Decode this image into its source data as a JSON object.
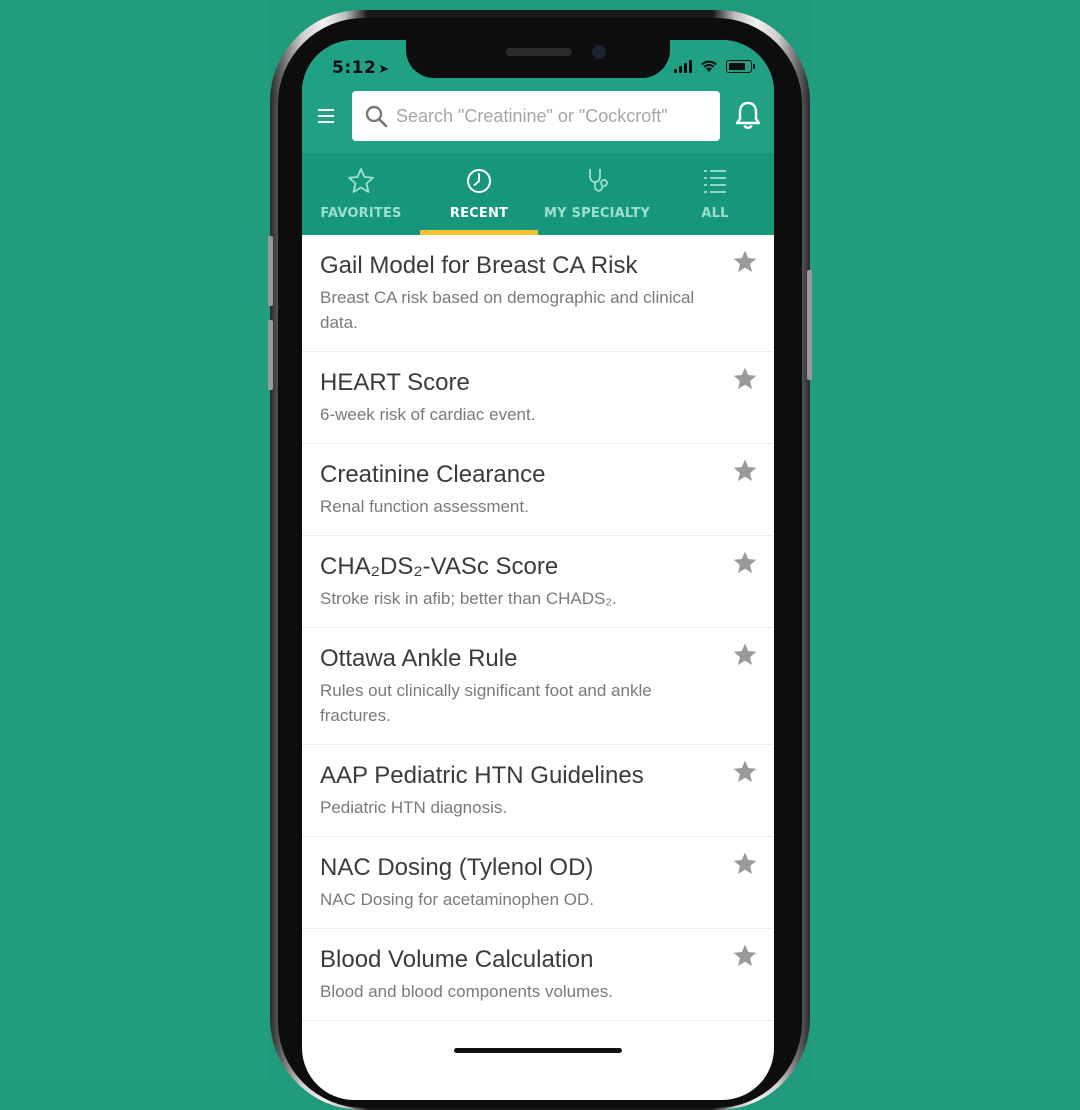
{
  "status_bar": {
    "time": "5:12"
  },
  "header": {
    "search_placeholder": "Search \"Creatinine\" or \"Cockcroft\""
  },
  "tabs": [
    {
      "label": "FAVORITES",
      "icon": "star-outline-icon",
      "active": false
    },
    {
      "label": "RECENT",
      "icon": "clock-icon",
      "active": true
    },
    {
      "label": "MY SPECIALTY",
      "icon": "stethoscope-icon",
      "active": false
    },
    {
      "label": "ALL",
      "icon": "list-icon",
      "active": false
    }
  ],
  "colors": {
    "background": "#1f9a7c",
    "header_green": "#21a183",
    "tabbar_green": "#16967a",
    "tab_underline": "#f2c230",
    "star_gray": "#9a9a9a"
  },
  "items": [
    {
      "title": "Gail Model for Breast CA Risk",
      "desc": "Breast CA risk based on demographic and clinical data."
    },
    {
      "title": "HEART Score",
      "desc": "6-week risk of cardiac event."
    },
    {
      "title": "Creatinine Clearance",
      "desc": "Renal function assessment."
    },
    {
      "title": "CHA₂DS₂-VASc Score",
      "desc": "Stroke risk in afib; better than CHADS₂."
    },
    {
      "title": "Ottawa Ankle Rule",
      "desc": "Rules out clinically significant foot and ankle fractures."
    },
    {
      "title": "AAP Pediatric HTN Guidelines",
      "desc": "Pediatric HTN diagnosis."
    },
    {
      "title": "NAC Dosing (Tylenol OD)",
      "desc": "NAC Dosing for acetaminophen OD."
    },
    {
      "title": "Blood Volume Calculation",
      "desc": "Blood and blood components volumes."
    }
  ]
}
